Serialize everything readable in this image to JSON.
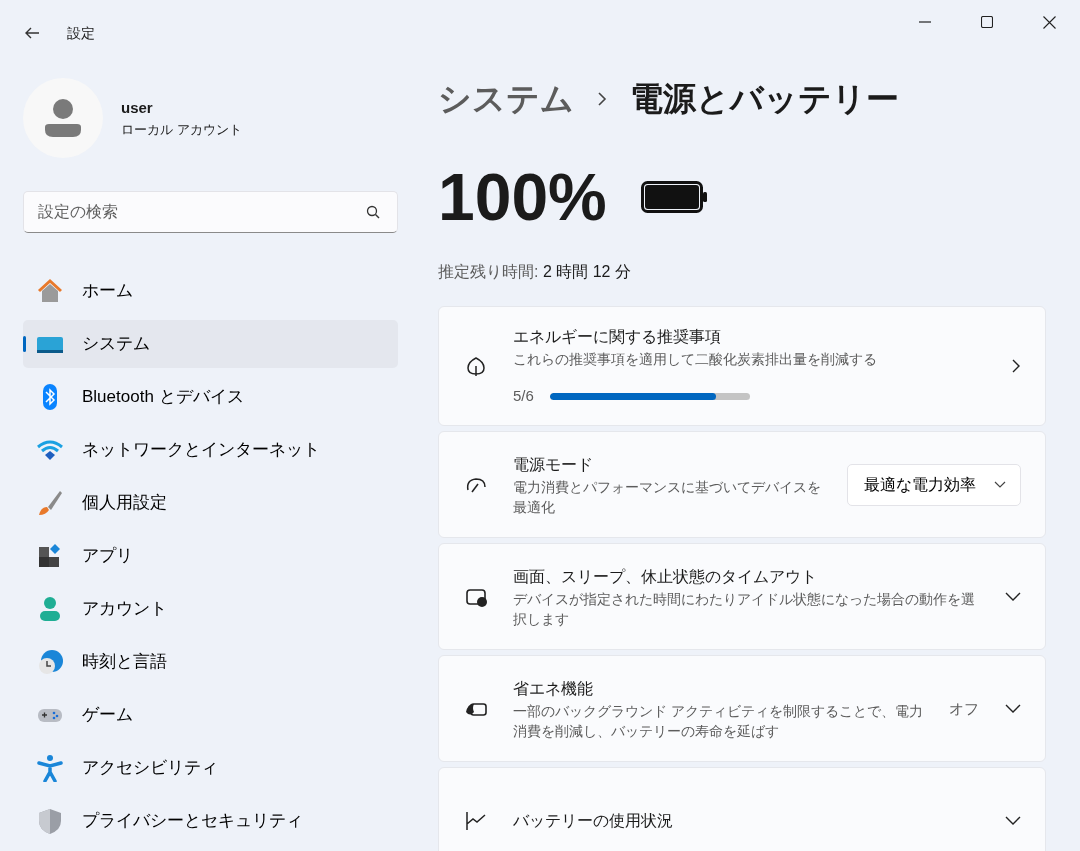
{
  "window": {
    "title": "設定"
  },
  "account": {
    "name": "user",
    "type": "ローカル アカウント"
  },
  "search": {
    "placeholder": "設定の検索"
  },
  "sidebar": {
    "items": [
      {
        "label": "ホーム",
        "selected": false
      },
      {
        "label": "システム",
        "selected": true
      },
      {
        "label": "Bluetooth とデバイス",
        "selected": false
      },
      {
        "label": "ネットワークとインターネット",
        "selected": false
      },
      {
        "label": "個人用設定",
        "selected": false
      },
      {
        "label": "アプリ",
        "selected": false
      },
      {
        "label": "アカウント",
        "selected": false
      },
      {
        "label": "時刻と言語",
        "selected": false
      },
      {
        "label": "ゲーム",
        "selected": false
      },
      {
        "label": "アクセシビリティ",
        "selected": false
      },
      {
        "label": "プライバシーとセキュリティ",
        "selected": false
      }
    ]
  },
  "breadcrumb": {
    "parent": "システム",
    "current": "電源とバッテリー"
  },
  "battery": {
    "percent": "100%",
    "level": 1,
    "remaining_label": "推定残り時間:",
    "remaining": "2 時間 12 分"
  },
  "cards": [
    {
      "kind": "progress",
      "title": "エネルギーに関する推奨事項",
      "description": "これらの推奨事項を適用して二酸化炭素排出量を削減する",
      "progress_text": "5/6",
      "level": 0.833
    },
    {
      "kind": "dropdown",
      "title": "電源モード",
      "description": "電力消費とパフォーマンスに基づいてデバイスを最適化",
      "value": "最適な電力効率"
    },
    {
      "kind": "expander",
      "title": "画面、スリープ、休止状態のタイムアウト",
      "description": "デバイスが指定された時間にわたりアイドル状態になった場合の動作を選択します"
    },
    {
      "kind": "expander",
      "title": "省エネ機能",
      "description": "一部のバックグラウンド アクティビティを制限することで、電力消費を削減し、バッテリーの寿命を延ばす",
      "value": "オフ"
    },
    {
      "kind": "expander",
      "title": "バッテリーの使用状況"
    }
  ]
}
